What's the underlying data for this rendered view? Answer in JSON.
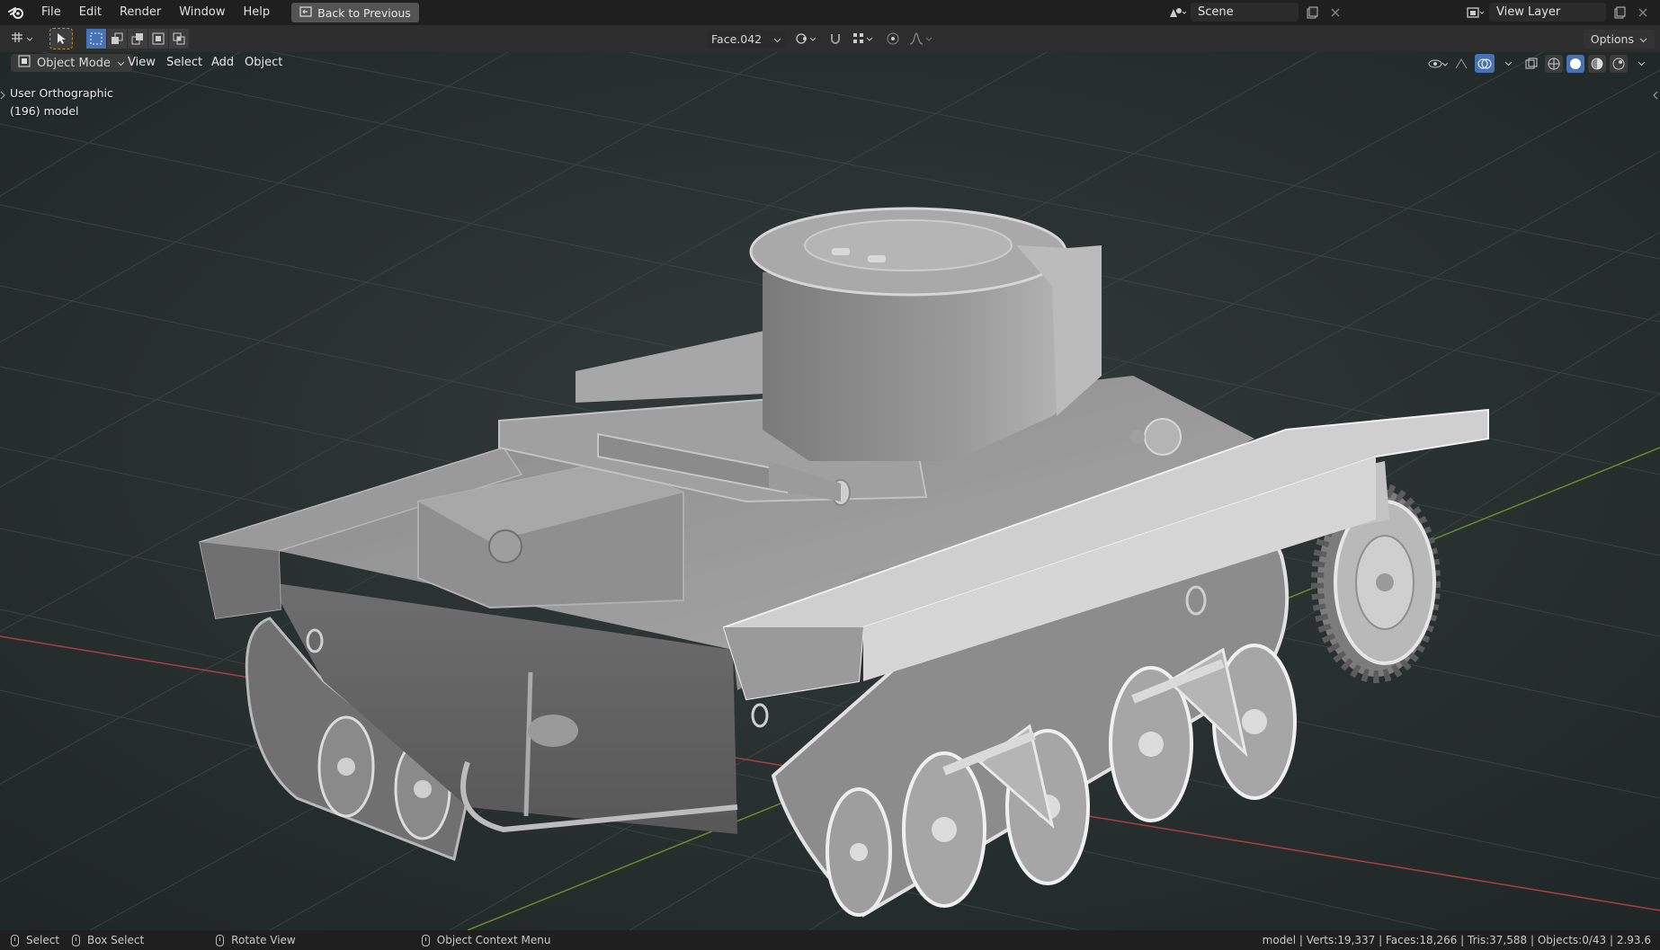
{
  "menu": {
    "items": [
      "File",
      "Edit",
      "Render",
      "Window",
      "Help"
    ],
    "back_button": "Back to Previous"
  },
  "scene": {
    "label": "Scene"
  },
  "view_layer": {
    "label": "View Layer"
  },
  "tool_header": {
    "active_object_field": "Face.042",
    "options_label": "Options"
  },
  "viewport": {
    "mode": "Object Mode",
    "menus": [
      "View",
      "Select",
      "Add",
      "Object"
    ],
    "overlay_view_name": "User Orthographic",
    "overlay_object": "(196) model",
    "shading_modes": [
      "wireframe",
      "solid",
      "material-preview",
      "rendered"
    ],
    "active_shading": "solid"
  },
  "status_bar": {
    "left_actions": [
      "Select",
      "Box Select",
      "Rotate View",
      "Object Context Menu"
    ],
    "stats": "model | Verts:19,337 | Faces:18,266 | Tris:37,588 | Objects:0/43 | 2.93.6"
  },
  "colors": {
    "viewport_bg": "#3a3a3a",
    "accent": "#4772b3",
    "grid_x_axis": "#a8403f",
    "grid_y_axis": "#6a8a2e"
  },
  "icons": [
    "blender-logo-icon",
    "back-arrow-icon",
    "scene-icon",
    "view-layer-icon",
    "cursor-icon",
    "select-box-icon",
    "transform-pivot-icon",
    "snap-icon",
    "proportional-edit-icon",
    "visibility-icon",
    "gizmo-icon",
    "overlay-icon",
    "xray-icon",
    "shading-icon",
    "mouse-left-icon",
    "mouse-middle-icon",
    "mouse-right-icon"
  ]
}
